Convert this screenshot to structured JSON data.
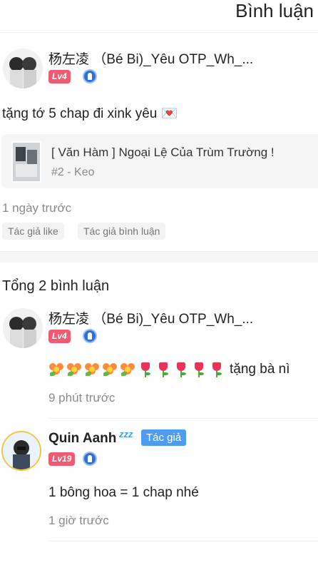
{
  "header": {
    "title": "Bình luận"
  },
  "main_comment": {
    "username": "杨左凌 （Bé Bi)_Yêu OTP_Wh_...",
    "level": "Lv4",
    "content": "tặng tớ 5 chap đi xink yêu 💌",
    "chapter": {
      "title": "[ Văn Hàm ] Ngoại Lệ Của Trùm Trường !",
      "subtitle": "#2 - Keo"
    },
    "time": "1 ngày trước",
    "tags": [
      "Tác giả like",
      "Tác giả bình luận"
    ]
  },
  "replies_section": {
    "total": "Tổng 2 bình luận"
  },
  "replies": [
    {
      "username": "杨左凌 （Bé Bi)_Yêu OTP_Wh_...",
      "level": "Lv4",
      "content_suffix": "tặng bà nì",
      "flower_count": 5,
      "tulip_count": 5,
      "time": "9 phút trước"
    },
    {
      "username": "Quin Aanh",
      "username_decoration": "zzz",
      "author_tag": "Tác giả",
      "level": "Lv19",
      "content": "1 bông hoa = 1 chap nhé ",
      "time": "1 giờ trước"
    }
  ],
  "colors": {
    "level_badge": "#f05b72",
    "author_tag": "#4e9cf2",
    "verified_badge": "#2f6fd6"
  },
  "icons": {
    "verified": "shield-badge-icon",
    "flower": "flower-bouquet-icon",
    "tulip": "tulip-icon"
  }
}
